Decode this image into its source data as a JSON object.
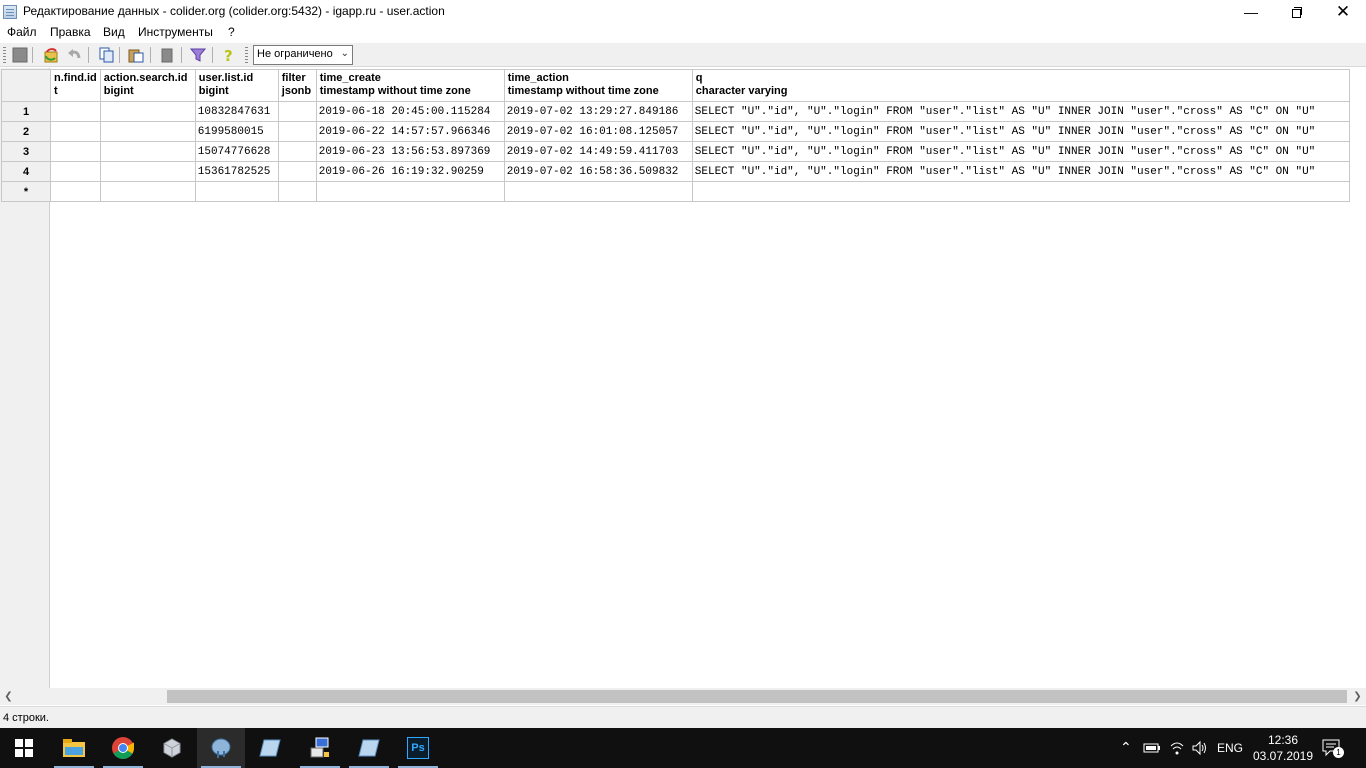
{
  "window": {
    "title": "Редактирование данных - colider.org (colider.org:5432) - igapp.ru - user.action",
    "minimize": "—",
    "close": "✕"
  },
  "menu": [
    "Файл",
    "Правка",
    "Вид",
    "Инструменты",
    "?"
  ],
  "toolbar": {
    "limit_value": "Не ограничено"
  },
  "grid": {
    "columns": [
      {
        "name": "n.find.id",
        "type": "t"
      },
      {
        "name": "action.search.id",
        "type": "bigint"
      },
      {
        "name": "user.list.id",
        "type": "bigint"
      },
      {
        "name": "filter",
        "type": "jsonb"
      },
      {
        "name": "time_create",
        "type": "timestamp without time zone"
      },
      {
        "name": "time_action",
        "type": "timestamp without time zone"
      },
      {
        "name": "q",
        "type": "character varying"
      }
    ],
    "rows": [
      {
        "num": "1",
        "cells": [
          "",
          "",
          "10832847631",
          "",
          "2019-06-18 20:45:00.115284",
          "2019-07-02 13:29:27.849186",
          "SELECT \"U\".\"id\", \"U\".\"login\" FROM \"user\".\"list\" AS \"U\" INNER JOIN \"user\".\"cross\" AS \"C\" ON \"U\""
        ]
      },
      {
        "num": "2",
        "cells": [
          "",
          "",
          "6199580015",
          "",
          "2019-06-22 14:57:57.966346",
          "2019-07-02 16:01:08.125057",
          "SELECT \"U\".\"id\", \"U\".\"login\" FROM \"user\".\"list\" AS \"U\" INNER JOIN \"user\".\"cross\" AS \"C\" ON \"U\""
        ]
      },
      {
        "num": "3",
        "cells": [
          "",
          "",
          "15074776628",
          "",
          "2019-06-23 13:56:53.897369",
          "2019-07-02 14:49:59.411703",
          "SELECT \"U\".\"id\", \"U\".\"login\" FROM \"user\".\"list\" AS \"U\" INNER JOIN \"user\".\"cross\" AS \"C\" ON \"U\""
        ]
      },
      {
        "num": "4",
        "cells": [
          "",
          "",
          "15361782525",
          "",
          "2019-06-26 16:19:32.90259",
          "2019-07-02 16:58:36.509832",
          "SELECT \"U\".\"id\", \"U\".\"login\" FROM \"user\".\"list\" AS \"U\" INNER JOIN \"user\".\"cross\" AS \"C\" ON \"U\""
        ]
      }
    ],
    "new_row_marker": "*"
  },
  "status": {
    "text": "4 строки."
  },
  "taskbar": {
    "apps": [
      "start-icon",
      "file-explorer-icon",
      "chrome-icon",
      "app-icon",
      "pgadmin-icon",
      "notes-icon",
      "network-app-icon",
      "notes2-icon",
      "photoshop-icon"
    ],
    "photoshop_label": "Ps",
    "language": "ENG",
    "time": "12:36",
    "date": "03.07.2019",
    "notification_count": "1"
  }
}
